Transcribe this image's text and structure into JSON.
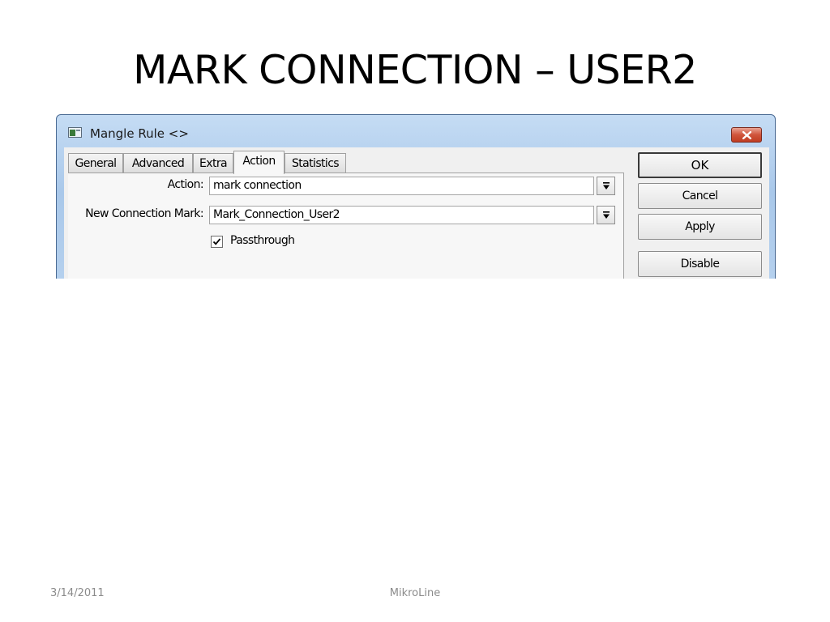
{
  "slide": {
    "title": "MARK CONNECTION – USER2",
    "footer_date": "3/14/2011",
    "footer_center": "MikroLine"
  },
  "window": {
    "title": "Mangle Rule <>",
    "icon": "window-app-icon",
    "close_icon": "close-icon"
  },
  "tabs": [
    {
      "label": "General",
      "active": false
    },
    {
      "label": "Advanced",
      "active": false
    },
    {
      "label": "Extra",
      "active": false
    },
    {
      "label": "Action",
      "active": true
    },
    {
      "label": "Statistics",
      "active": false
    }
  ],
  "form": {
    "action_label": "Action:",
    "action_value": "mark connection",
    "new_connection_mark_label": "New Connection Mark:",
    "new_connection_mark_value": "Mark_Connection_User2",
    "passthrough_label": "Passthrough",
    "passthrough_checked": true
  },
  "buttons": {
    "ok": "OK",
    "cancel": "Cancel",
    "apply": "Apply",
    "disable": "Disable"
  },
  "colors": {
    "titlebar": "#b9d3ef",
    "close_button": "#c9482f",
    "dialog_bg": "#f0f0f0"
  }
}
